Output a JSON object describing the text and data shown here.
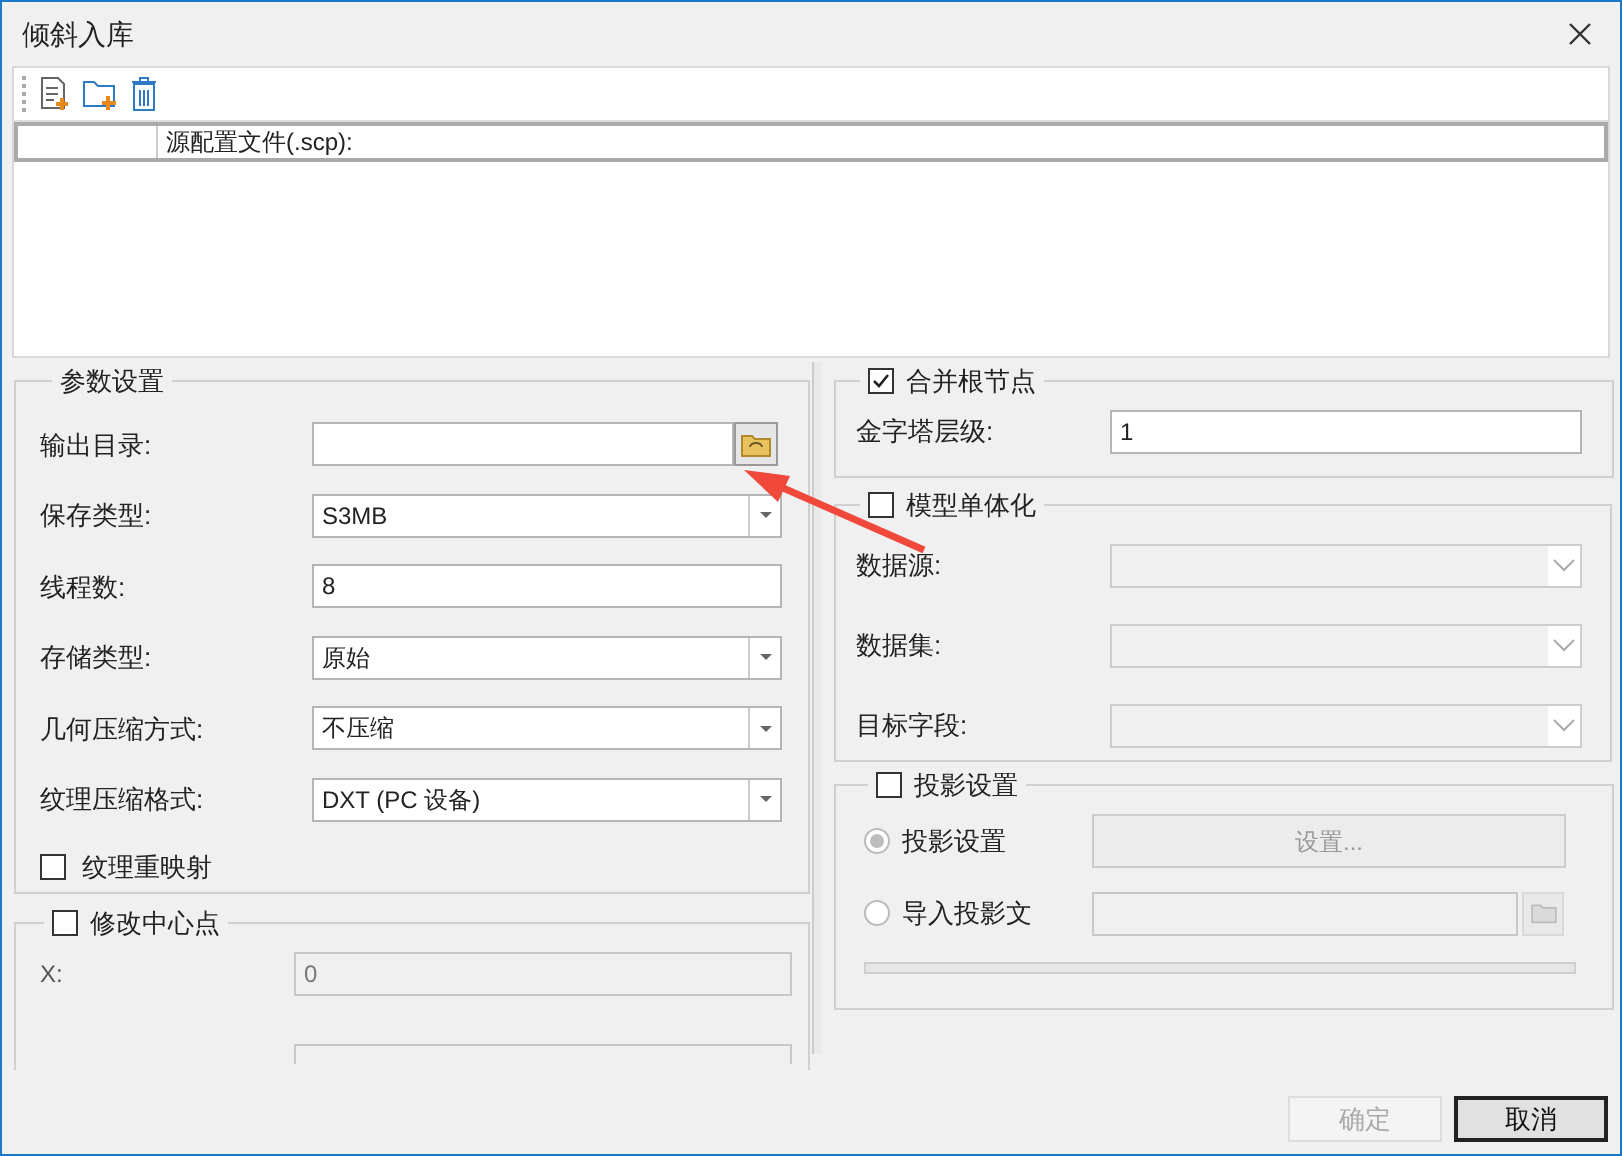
{
  "window": {
    "title": "倾斜入库"
  },
  "source_table": {
    "column_2": "源配置文件(.scp):"
  },
  "params": {
    "title": "参数设置",
    "fields": [
      {
        "kind": "browse",
        "label": "输出目录:"
      },
      {
        "kind": "dropdown",
        "label": "保存类型:",
        "value": "S3MB"
      },
      {
        "kind": "text",
        "label": "线程数:",
        "value": "8"
      },
      {
        "kind": "dropdown",
        "label": "存储类型:",
        "value": "原始"
      },
      {
        "kind": "dropdown",
        "label": "几何压缩方式:",
        "value": "不压缩"
      },
      {
        "kind": "dropdown",
        "label": "纹理压缩格式:",
        "value": "DXT (PC 设备)"
      }
    ],
    "texture_remap": {
      "label": "纹理重映射",
      "checked": false
    }
  },
  "center_point": {
    "label": "修改中心点",
    "checked": false,
    "fields": [
      {
        "label": "X:",
        "value": "0"
      }
    ]
  },
  "merge_root": {
    "label": "合并根节点",
    "checked": true,
    "fields": [
      {
        "label": "金字塔层级:",
        "value": "1"
      }
    ]
  },
  "model_singulation": {
    "label": "模型单体化",
    "checked": false,
    "fields": [
      {
        "label": "数据源:"
      },
      {
        "label": "数据集:"
      },
      {
        "label": "目标字段:"
      }
    ]
  },
  "projection": {
    "label": "投影设置",
    "checked": false,
    "options": [
      {
        "kind": "button",
        "label": "投影设置",
        "selected": true,
        "button": "设置..."
      },
      {
        "kind": "file",
        "label": "导入投影文",
        "selected": false
      }
    ],
    "progress": {
      "level": 0
    }
  },
  "buttons": [
    {
      "label": "确定",
      "disabled": true,
      "default": false
    },
    {
      "label": "取消",
      "disabled": false,
      "default": true
    }
  ]
}
